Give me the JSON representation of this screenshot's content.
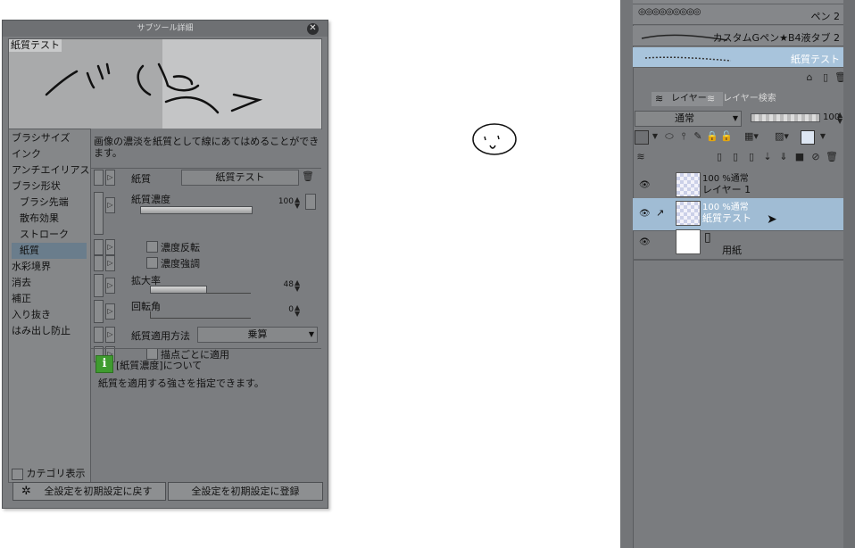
{
  "dialog": {
    "title": "サブツール詳細",
    "preview_label": "紙質テスト",
    "description": "画像の濃淡を紙質として線にあてはめることができます。",
    "categories": [
      {
        "label": "ブラシサイズ",
        "sub": false,
        "selected": false
      },
      {
        "label": "インク",
        "sub": false,
        "selected": false
      },
      {
        "label": "アンチエイリアス",
        "sub": false,
        "selected": false
      },
      {
        "label": "ブラシ形状",
        "sub": false,
        "selected": false
      },
      {
        "label": "ブラシ先端",
        "sub": true,
        "selected": false
      },
      {
        "label": "散布効果",
        "sub": true,
        "selected": false
      },
      {
        "label": "ストローク",
        "sub": true,
        "selected": false
      },
      {
        "label": "紙質",
        "sub": true,
        "selected": true
      },
      {
        "label": "水彩境界",
        "sub": false,
        "selected": false
      },
      {
        "label": "消去",
        "sub": false,
        "selected": false
      },
      {
        "label": "補正",
        "sub": false,
        "selected": false
      },
      {
        "label": "入り抜き",
        "sub": false,
        "selected": false
      },
      {
        "label": "はみ出し防止",
        "sub": false,
        "selected": false
      }
    ],
    "category_toggle": "カテゴリ表示",
    "props": {
      "paper_label": "紙質",
      "paper_value": "紙質テスト",
      "density_label": "紙質濃度",
      "density_value": "100",
      "density_level": 1.0,
      "invert_label": "濃度反転",
      "emphasis_label": "濃度強調",
      "scale_label": "拡大率",
      "scale_value": "48",
      "scale_level": 0.48,
      "rotation_label": "回転角",
      "rotation_value": "0",
      "apply_label": "紙質適用方法",
      "apply_value": "乗算",
      "per_dot_label": "描点ごとに適用"
    },
    "info_title": "[紙質濃度]について",
    "info_text": "紙質を適用する強さを指定できます。",
    "reset_button": "全設定を初期設定に戻す",
    "register_button": "全設定を初期設定に登録"
  },
  "brushes": [
    {
      "name": "ペン 2",
      "selected": false
    },
    {
      "name": "カスタムGペン★B4液タブ 2",
      "selected": false
    },
    {
      "name": "紙質テスト",
      "selected": true
    }
  ],
  "layer_panel": {
    "tab_layer": "レイヤー",
    "tab_search": "レイヤー検索",
    "blend_mode": "通常",
    "opacity": "100",
    "opacity_level": 1.0,
    "layers": [
      {
        "line1": "100 %通常",
        "line2": "レイヤー 1",
        "selected": false
      },
      {
        "line1": "100 %通常",
        "line2": "紙質テスト",
        "selected": true
      },
      {
        "line1": "",
        "line2": "用紙",
        "selected": false
      }
    ]
  },
  "colors": {
    "panel_bg": "#7b7d80",
    "selection": "#a0bcd4",
    "info_green": "#3f9b2f"
  }
}
